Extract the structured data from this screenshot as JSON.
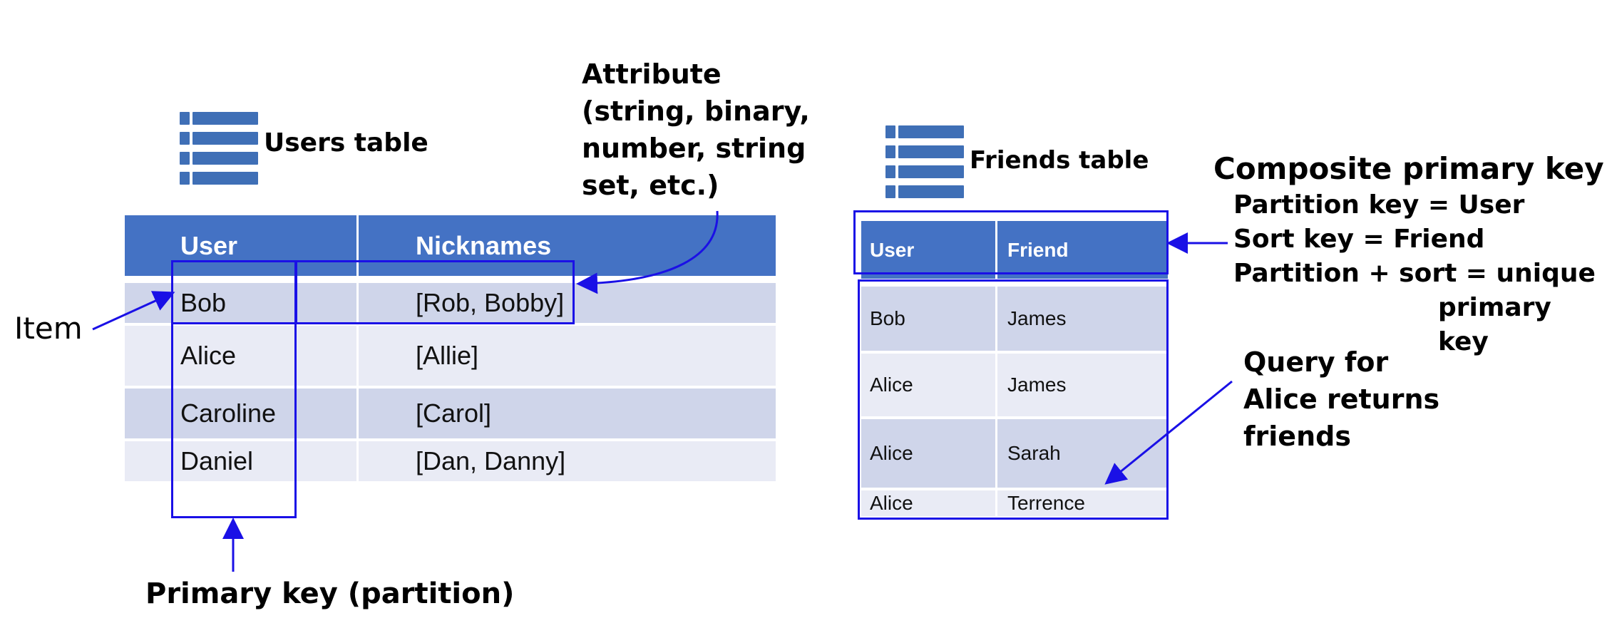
{
  "users": {
    "title": "Users table",
    "columns": [
      "User",
      "Nicknames"
    ],
    "rows": [
      [
        "Bob",
        "[Rob, Bobby]"
      ],
      [
        "Alice",
        "[Allie]"
      ],
      [
        "Caroline",
        "[Carol]"
      ],
      [
        "Daniel",
        "[Dan, Danny]"
      ]
    ]
  },
  "friends": {
    "title": "Friends table",
    "columns": [
      "User",
      "Friend"
    ],
    "rows": [
      [
        "Bob",
        "James"
      ],
      [
        "Alice",
        "James"
      ],
      [
        "Alice",
        "Sarah"
      ],
      [
        "Alice",
        "Terrence"
      ]
    ]
  },
  "annotations": {
    "attribute": [
      "Attribute",
      "(string, binary,",
      "number, string",
      "set, etc.)"
    ],
    "item": "Item",
    "primary_key": "Primary key (partition)",
    "composite_title": "Composite primary key",
    "composite_lines": [
      "Partition key = User",
      "Sort key = Friend",
      "Partition + sort = unique",
      "primary key"
    ],
    "query": [
      "Query for",
      "Alice returns",
      "friends"
    ]
  },
  "colors": {
    "header_bg": "#4472c4",
    "row_dark": "#cfd5ea",
    "row_light": "#e9ebf5",
    "highlight": "#1a10e6",
    "icon": "#3f6fb6"
  },
  "icons": [
    "table-icon",
    "table-icon"
  ]
}
